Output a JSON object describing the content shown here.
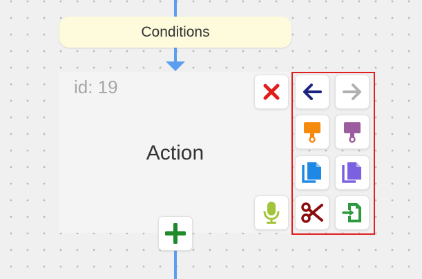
{
  "flow": {
    "conditions_label": "Conditions",
    "action": {
      "id_text": "id: 19",
      "label": "Action"
    }
  },
  "icons": {
    "delete": "close-icon",
    "voice": "microphone-icon",
    "add": "plus-icon",
    "undo": "arrow-left-icon",
    "redo": "arrow-right-icon",
    "paint_orange": "paint-brush-icon",
    "paint_purple": "paint-brush-icon",
    "copy_blue": "copy-icon",
    "copy_purple": "copy-icon",
    "cut": "scissors-icon",
    "insert": "import-icon"
  },
  "colors": {
    "connector": "#5b9ef0",
    "conditions_bg": "#fdfbdc",
    "panel_border": "#e01f1f",
    "delete": "#e21b1b",
    "add": "#1e8a2a",
    "undo": "#1a237e",
    "redo": "#b0b0b0",
    "paint_orange": "#f58a0c",
    "paint_purple": "#9c5d9e",
    "copy_blue": "#1e88e5",
    "copy_purple": "#7b61e0",
    "cut": "#8b0d0d",
    "insert": "#2e9a3e",
    "voice": "#a2c43a"
  }
}
